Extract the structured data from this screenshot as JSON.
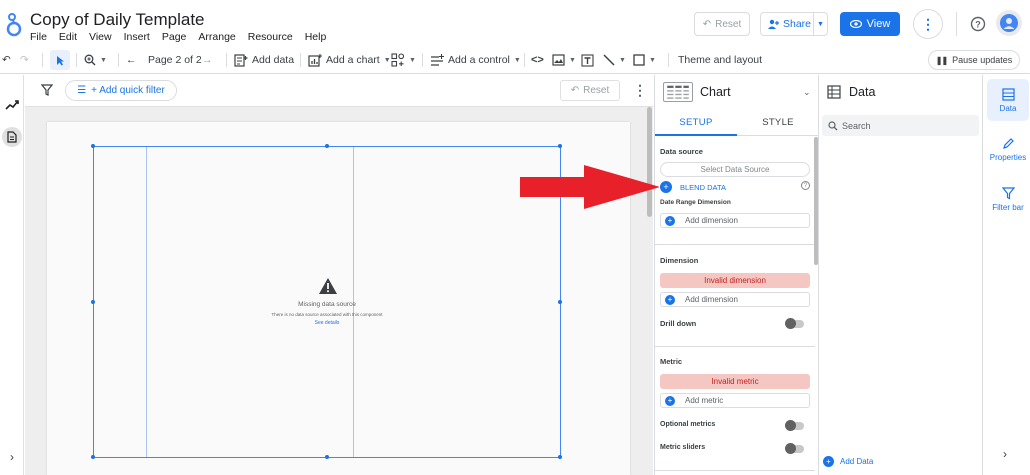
{
  "header": {
    "title": "Copy of Daily Template",
    "menu": [
      "File",
      "Edit",
      "View",
      "Insert",
      "Page",
      "Arrange",
      "Resource",
      "Help"
    ],
    "reset_label": "Reset",
    "share_label": "Share",
    "view_label": "View",
    "accent": "#1a73e8"
  },
  "toolbar": {
    "page_indicator": "Page 2 of 2",
    "add_data": "Add data",
    "add_chart": "Add a chart",
    "add_control": "Add a control",
    "theme_layout": "Theme and layout",
    "pause_updates": "Pause updates"
  },
  "canvas": {
    "quick_filter": "+ Add quick filter",
    "reset_label": "Reset",
    "missing_title": "Missing data source",
    "missing_sub": "There is no data source associated with this component",
    "see_details": "See details"
  },
  "properties": {
    "chart_name": "Chart",
    "tabs": [
      "SETUP",
      "STYLE"
    ],
    "data_source_label": "Data source",
    "select_data_source": "Select Data Source",
    "blend_data": "BLEND DATA",
    "date_range_label": "Date Range Dimension",
    "add_dimension": "Add dimension",
    "dimension_label": "Dimension",
    "invalid_dimension": "Invalid dimension",
    "drill_down": "Drill down",
    "metric_label": "Metric",
    "invalid_metric": "Invalid metric",
    "add_metric": "Add metric",
    "optional_metrics": "Optional metrics",
    "metric_sliders": "Metric sliders",
    "invalid_color": "#f4c7c3"
  },
  "data_panel": {
    "title": "Data",
    "search_placeholder": "Search",
    "add_data": "Add Data"
  },
  "right_rail": {
    "items": [
      "Data",
      "Properties",
      "Filter bar"
    ]
  },
  "annotation": {
    "arrow_color": "#e8202a"
  }
}
